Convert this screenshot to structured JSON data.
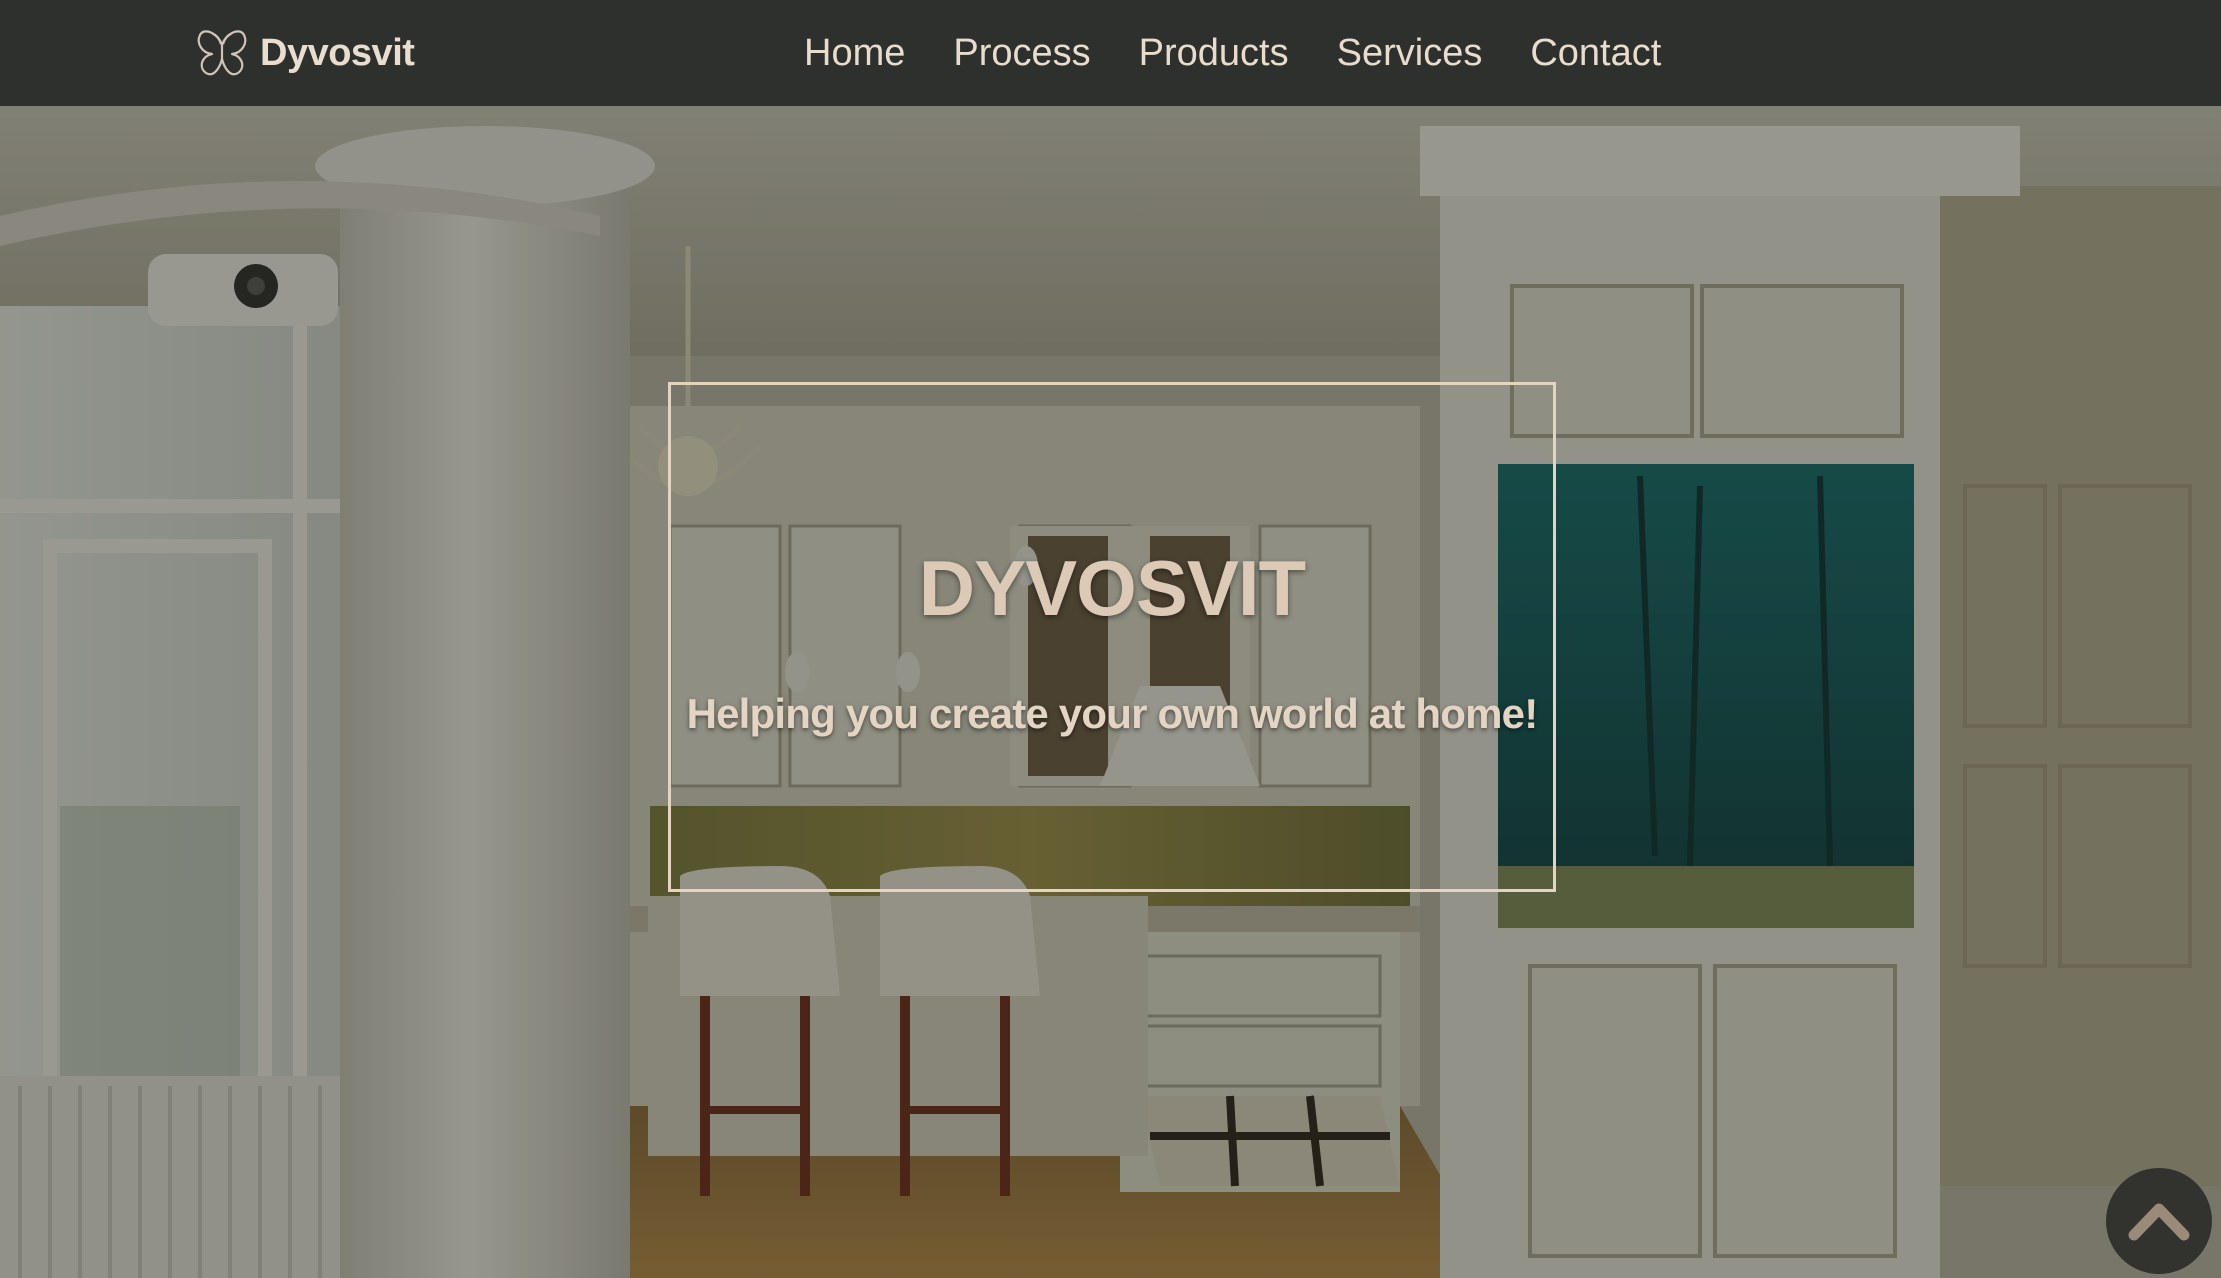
{
  "navbar": {
    "brand": {
      "name": "Dyvosvit",
      "icon": "butterfly-icon"
    },
    "links": [
      {
        "label": "Home"
      },
      {
        "label": "Process"
      },
      {
        "label": "Products"
      },
      {
        "label": "Services"
      },
      {
        "label": "Contact"
      }
    ]
  },
  "hero": {
    "title": "DYVOSVIT",
    "subtitle": "Helping you create your own world at home!",
    "background": "kitchen-interior-with-aquarium-photo"
  },
  "back_to_top": {
    "icon": "chevron-up-icon"
  },
  "colors": {
    "navbar_bg": "#2e302e",
    "nav_text": "#e8dccd",
    "hero_text": "#dcc9b6",
    "hero_border": "#e4d3c1",
    "accent_chevron": "#9a8a78"
  }
}
